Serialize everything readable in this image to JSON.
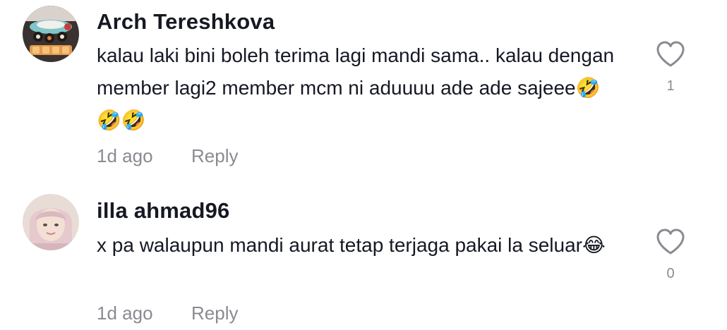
{
  "comments": [
    {
      "username": "Arch Tereshkova",
      "text": "kalau laki bini boleh terima lagi mandi sama.. kalau dengan member lagi2 member mcm ni aduuuu ade ade sajeee🤣🤣🤣",
      "time": "1d ago",
      "reply_label": "Reply",
      "likes": "1"
    },
    {
      "username": "illa ahmad96",
      "text": "x pa walaupun mandi aurat tetap terjaga pakai la seluar😂",
      "time": "1d ago",
      "reply_label": "Reply",
      "likes": "0"
    }
  ],
  "icons": {
    "like": "heart-outline-icon"
  },
  "colors": {
    "text_primary": "#161823",
    "text_secondary": "#8a8b91",
    "icon_stroke": "#8a8b91"
  }
}
